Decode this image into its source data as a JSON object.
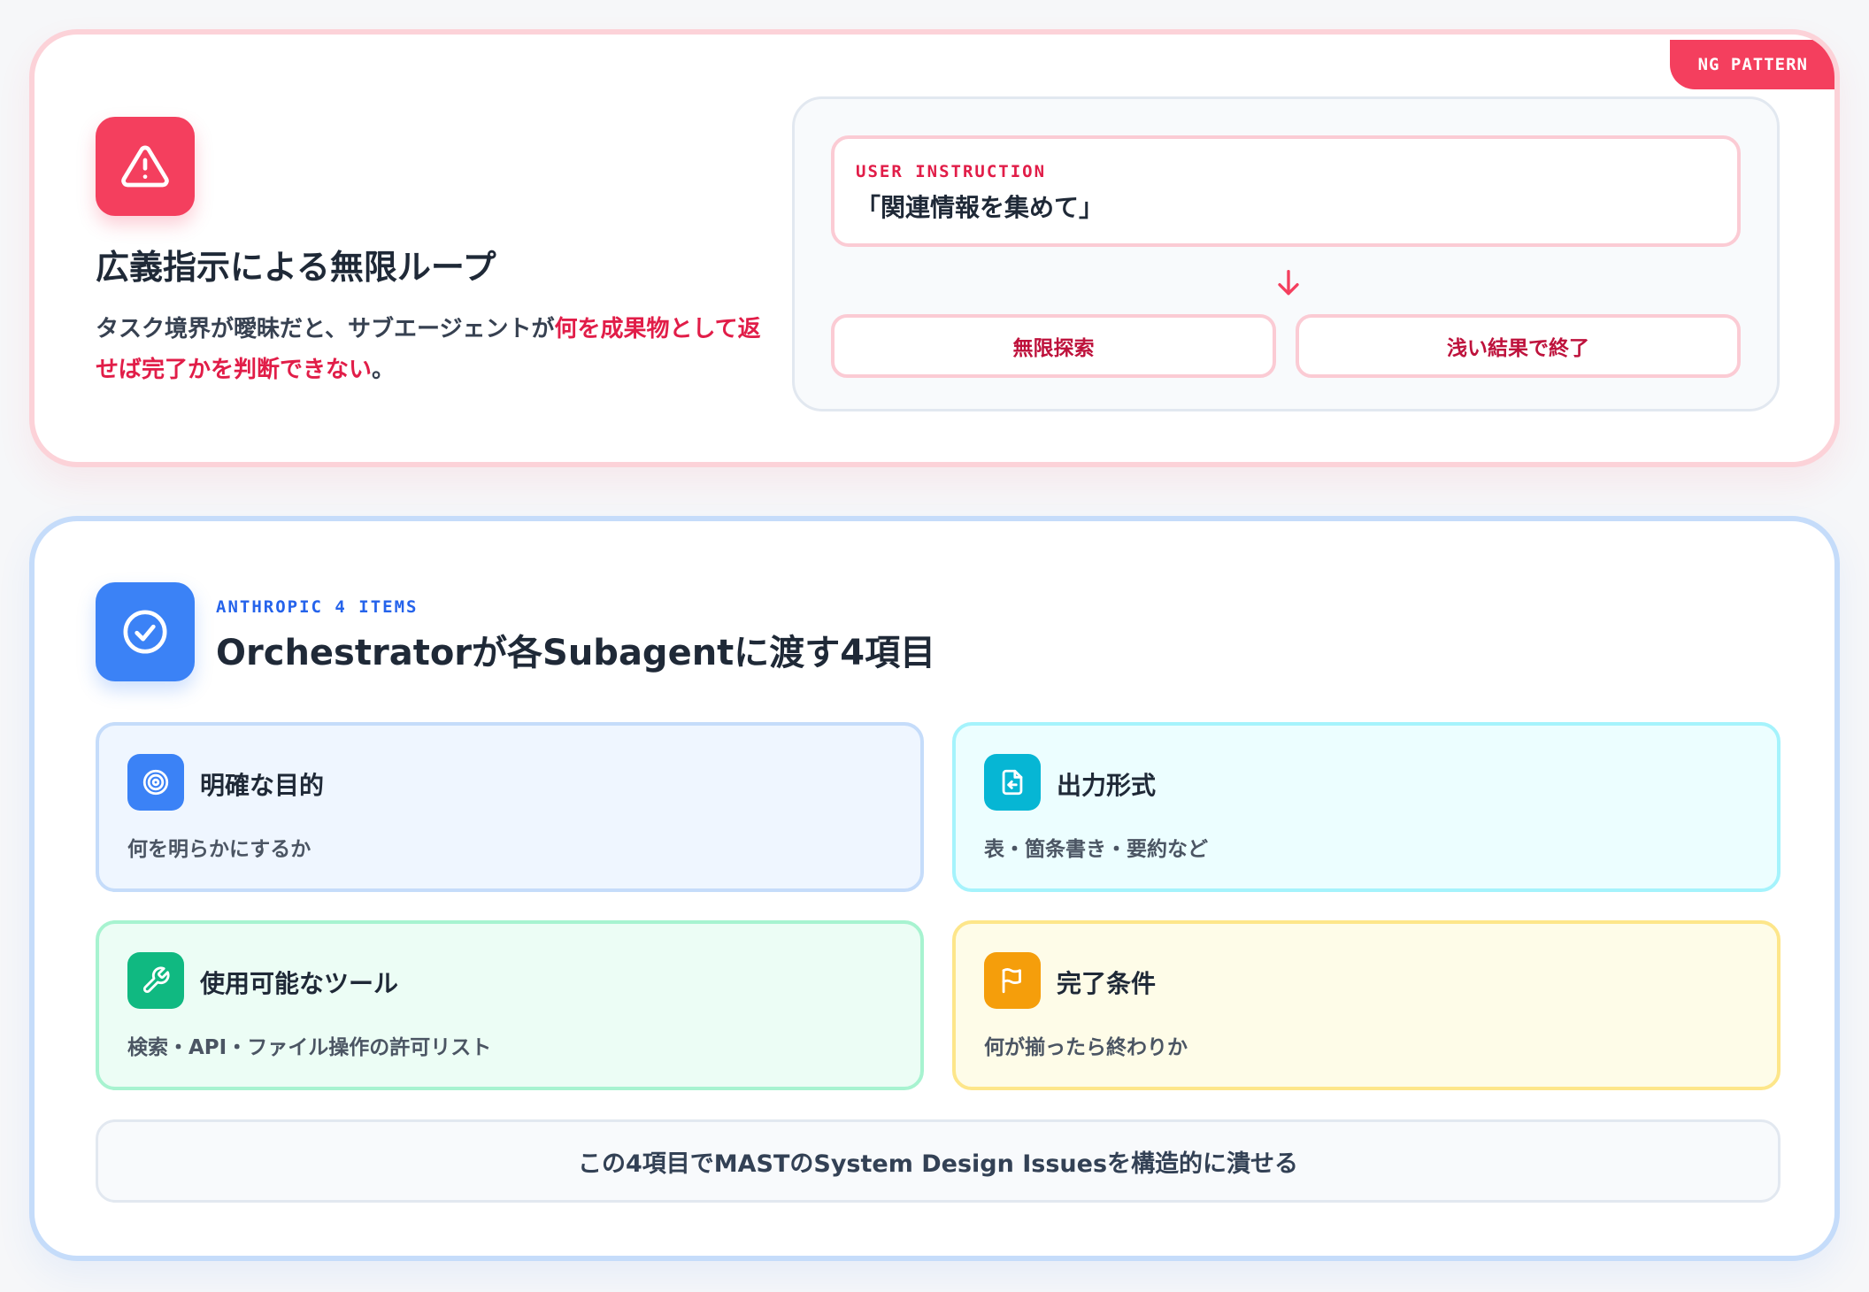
{
  "ng": {
    "badge": "NG PATTERN",
    "icon": "warning-triangle-icon",
    "title": "広義指示による無限ループ",
    "desc_lead": "タスク境界が曖昧だと、サブエージェントが",
    "desc_highlight": "何を成果物として返せば完了かを判断できない",
    "desc_tail": "。",
    "instruction_label": "USER INSTRUCTION",
    "instruction_text": "「関連情報を集めて」",
    "outcomes": [
      "無限探索",
      "浅い結果で終了"
    ],
    "accent": "#f43f5e"
  },
  "items": {
    "icon": "check-circle-icon",
    "eyebrow": "ANTHROPIC 4 ITEMS",
    "title": "Orchestratorが各Subagentに渡す4項目",
    "accent": "#3b82f6",
    "list": [
      {
        "icon": "target-icon",
        "title": "明確な目的",
        "desc": "何を明らかにするか"
      },
      {
        "icon": "file-export-icon",
        "title": "出力形式",
        "desc": "表・箇条書き・要約など"
      },
      {
        "icon": "wrench-icon",
        "title": "使用可能なツール",
        "desc": "検索・API・ファイル操作の許可リスト"
      },
      {
        "icon": "flag-icon",
        "title": "完了条件",
        "desc": "何が揃ったら終わりか"
      }
    ],
    "summary": "この4項目でMASTのSystem Design Issuesを構造的に潰せる"
  }
}
